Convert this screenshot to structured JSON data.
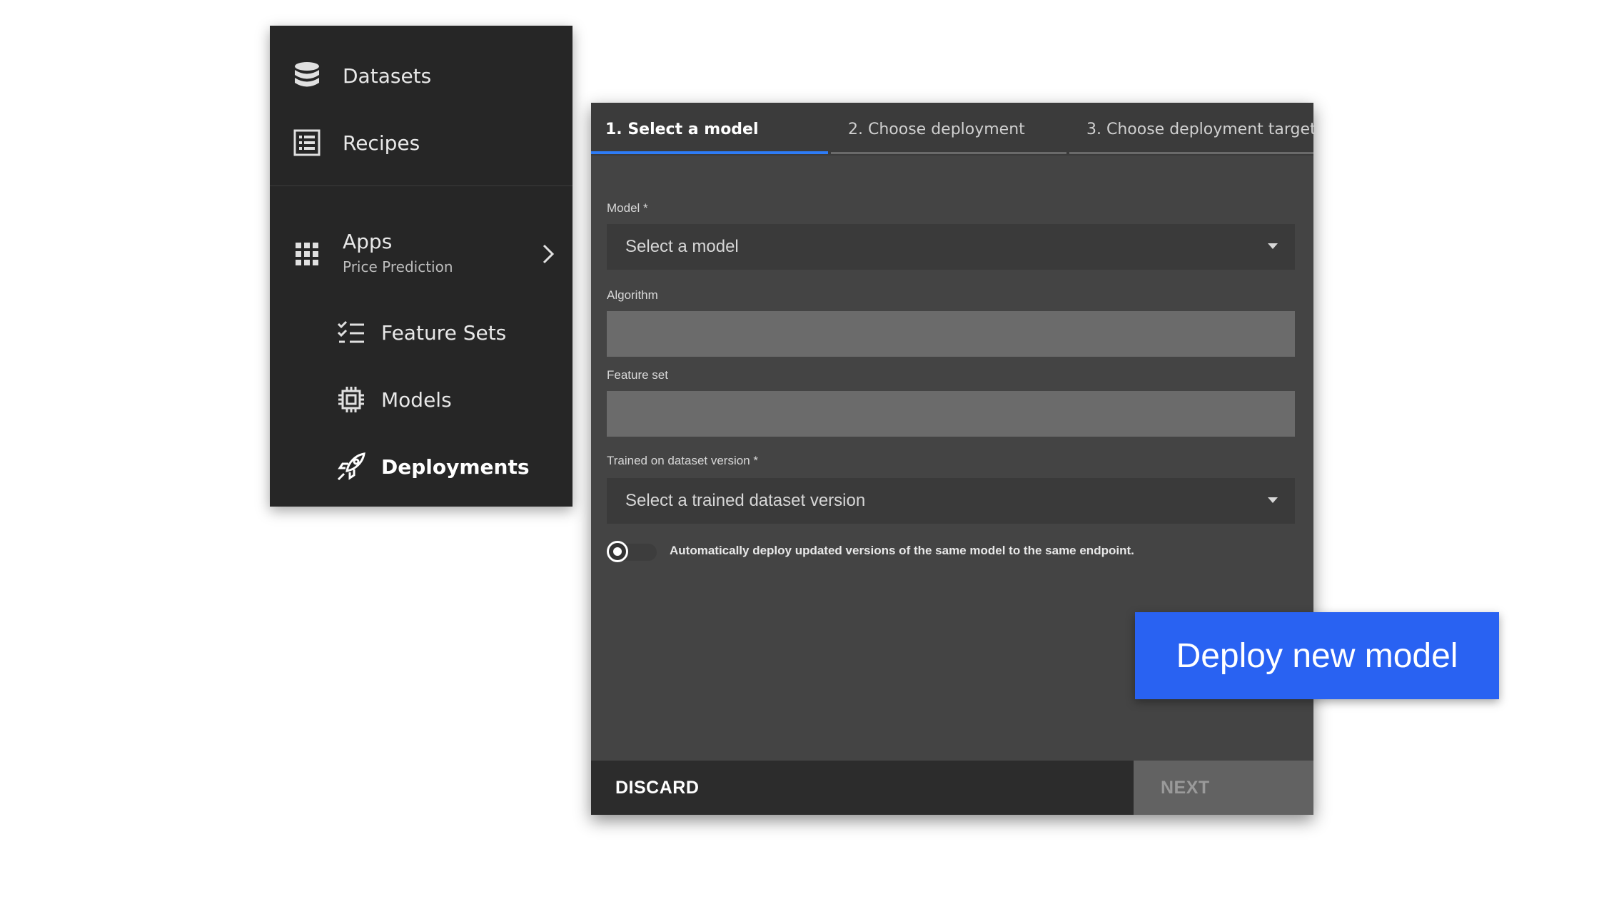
{
  "sidebar": {
    "items": [
      {
        "label": "Datasets",
        "icon": "database-icon"
      },
      {
        "label": "Recipes",
        "icon": "list-icon"
      },
      {
        "label": "Apps",
        "sublabel": "Price Prediction",
        "icon": "grid-icon",
        "chevron": "chevron-right-icon"
      },
      {
        "label": "Feature Sets",
        "icon": "checklist-icon"
      },
      {
        "label": "Models",
        "icon": "chip-icon"
      },
      {
        "label": "Deployments",
        "icon": "rocket-icon",
        "active": true
      }
    ]
  },
  "dialog": {
    "tabs": [
      {
        "label": "1. Select a model",
        "active": true
      },
      {
        "label": "2. Choose deployment"
      },
      {
        "label": "3. Choose deployment target"
      }
    ],
    "fields": {
      "model": {
        "label": "Model *",
        "placeholder": "Select a model"
      },
      "algorithm": {
        "label": "Algorithm",
        "value": ""
      },
      "feature_set": {
        "label": "Feature set",
        "value": ""
      },
      "dataset_version": {
        "label": "Trained on dataset version *",
        "placeholder": "Select a trained dataset version"
      }
    },
    "toggle": {
      "label": "Automatically deploy updated versions of the same model to the same endpoint.",
      "on": false
    },
    "footer": {
      "discard_label": "DISCARD",
      "next_label": "NEXT"
    }
  },
  "callout": {
    "text": "Deploy new model",
    "color": "#2962f2"
  },
  "colors": {
    "sidebar_bg": "#262626",
    "dialog_bg": "#444444",
    "tab_active_underline": "#2e7cf6"
  }
}
